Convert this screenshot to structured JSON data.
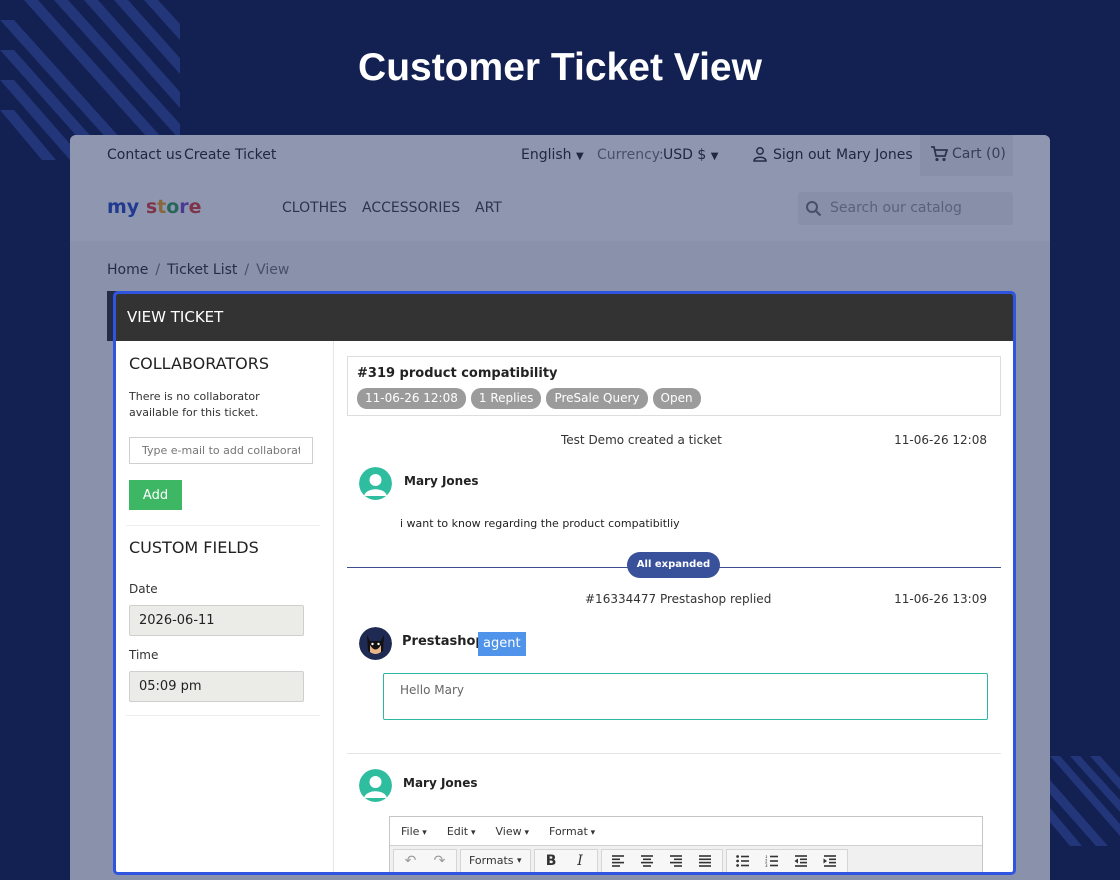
{
  "hero": {
    "title": "Customer Ticket View"
  },
  "topbar": {
    "contact": "Contact us",
    "create_ticket": "Create Ticket",
    "language": "English",
    "currency_label": "Currency:",
    "currency_value": "USD $",
    "sign_out": "Sign out",
    "user_name": "Mary Jones",
    "cart": "Cart (0)"
  },
  "navbar": {
    "logo": "my store",
    "links": [
      "CLOTHES",
      "ACCESSORIES",
      "ART"
    ],
    "search_placeholder": "Search our catalog"
  },
  "breadcrumb": {
    "home": "Home",
    "list": "Ticket List",
    "current": "View"
  },
  "ticket": {
    "header": "VIEW TICKET",
    "collaborators": {
      "title": "COLLABORATORS",
      "note": "There is no collaborator available for this ticket.",
      "input_placeholder": "Type e-mail to add collaborator",
      "add_label": "Add"
    },
    "custom_fields": {
      "title": "CUSTOM FIELDS",
      "date_label": "Date",
      "date_value": "2026-06-11",
      "time_label": "Time",
      "time_value": "05:09 pm"
    },
    "subject": "#319 product compatibility",
    "badges": [
      "11-06-26 12:08",
      "1 Replies",
      "PreSale Query",
      "Open"
    ],
    "thread": [
      {
        "event": "Test Demo created a ticket",
        "date": "11-06-26 12:08",
        "author": "Mary Jones",
        "message": "i want to know regarding the product compatibitliy"
      },
      {
        "event": "#16334477 Prestashop replied",
        "date": "11-06-26 13:09",
        "author": "Prestashop",
        "author_badge": "agent",
        "message": "Hello Mary"
      }
    ],
    "expanded_label": "All expanded",
    "reply_author": "Mary Jones",
    "editor": {
      "menus": [
        "File",
        "Edit",
        "View",
        "Format"
      ],
      "formats_label": "Formats",
      "bold": "B",
      "italic": "I"
    }
  },
  "colors": {
    "background": "#132052",
    "highlight_border": "#2f55e0",
    "ticket_header": "#333333",
    "add_button": "#3eb764",
    "agent_badge": "#4f93ea",
    "expanded_pill": "#39519a",
    "avatar_teal": "#2ebd9f"
  }
}
